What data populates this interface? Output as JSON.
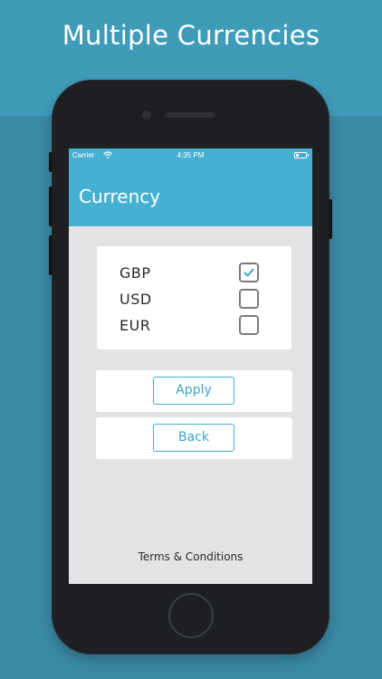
{
  "headline": "Multiple Currencies",
  "status": {
    "carrier": "Carrier",
    "time": "4:35 PM"
  },
  "nav": {
    "title": "Currency"
  },
  "currencies": [
    {
      "code": "GBP",
      "checked": true
    },
    {
      "code": "USD",
      "checked": false
    },
    {
      "code": "EUR",
      "checked": false
    }
  ],
  "actions": {
    "apply_label": "Apply",
    "back_label": "Back"
  },
  "footer": {
    "terms_label": "Terms & Conditions"
  },
  "colors": {
    "accent": "#46b0d3",
    "background": "#3f9cb9",
    "screen_bg": "#e3e3e3"
  }
}
